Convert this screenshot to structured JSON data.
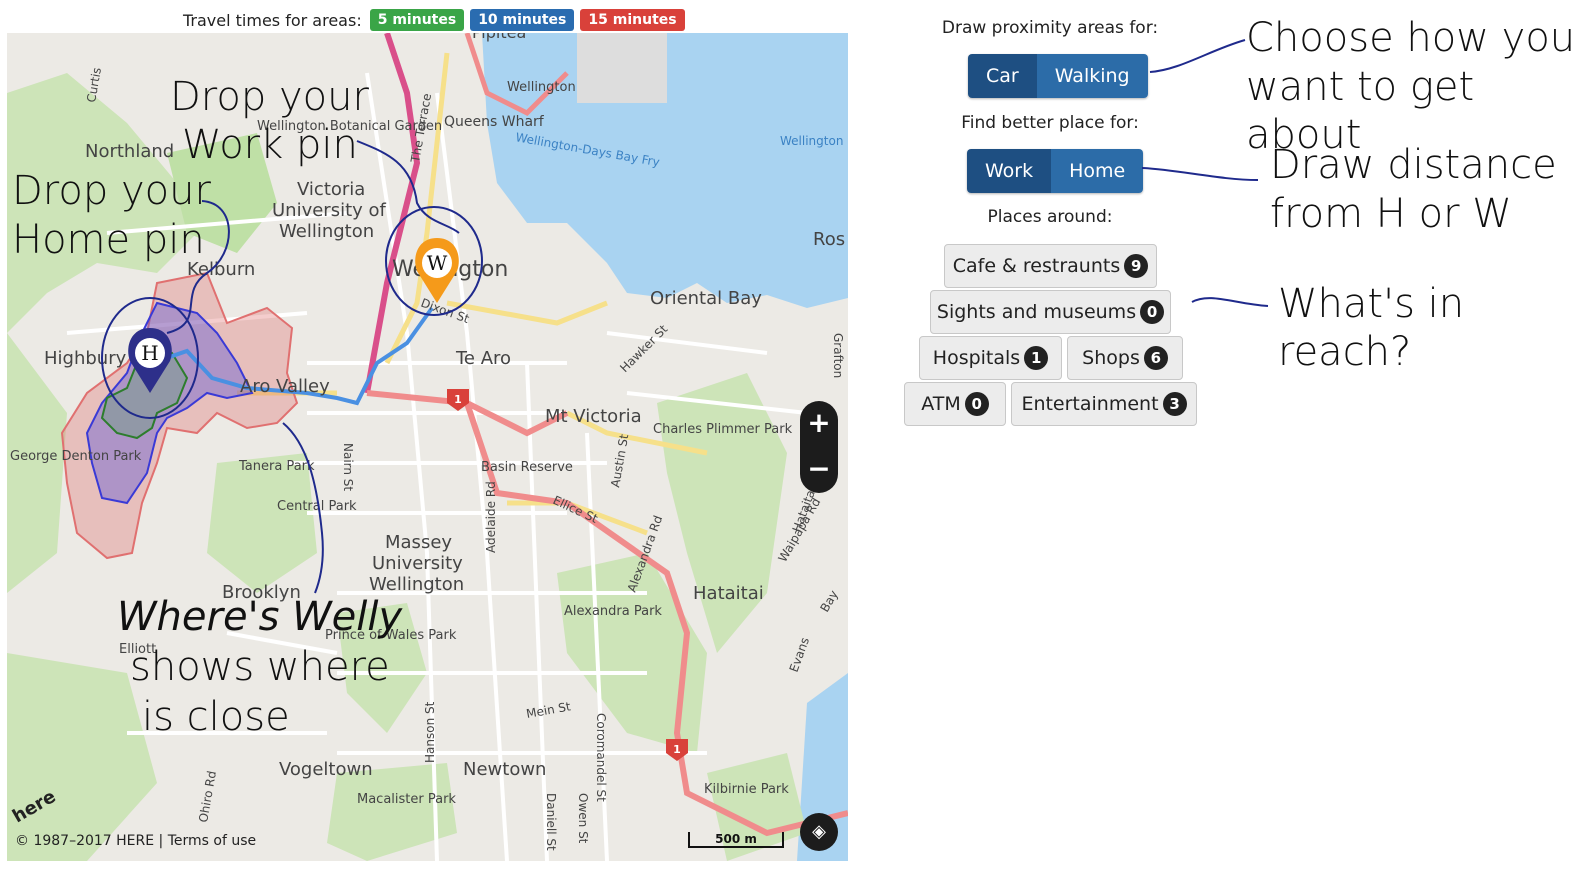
{
  "legend": {
    "label": "Travel times for areas:",
    "badges": [
      {
        "text": "5 minutes",
        "color": "#3aa547"
      },
      {
        "text": "10 minutes",
        "color": "#2a6cb0"
      },
      {
        "text": "15 minutes",
        "color": "#d9413a"
      }
    ]
  },
  "map": {
    "places": {
      "pipitea": "Pipitea",
      "wellington_top": "Wellington",
      "queens_wharf": "Queens Wharf",
      "botanical": "Wellington Botanical Garden",
      "northland": "Northland",
      "victoria_uni_1": "Victoria",
      "victoria_uni_2": "University of",
      "victoria_uni_3": "Wellington",
      "kelburn": "Kelburn",
      "wellington_city": "Wellington",
      "oriental_bay": "Oriental Bay",
      "highbury": "Highbury",
      "aro_valley": "Aro Valley",
      "te_aro": "Te Aro",
      "mt_victoria": "Mt Victoria",
      "charles_plimmer": "Charles Plimmer Park",
      "george_denton": "George Denton Park",
      "tanera": "Tanera Park",
      "central_park": "Central Park",
      "basin_reserve": "Basin Reserve",
      "massey_1": "Massey",
      "massey_2": "University",
      "massey_3": "Wellington",
      "brooklyn": "Brooklyn",
      "hataitai": "Hataitai",
      "alexandra_park": "Alexandra Park",
      "elliott": "Elliott",
      "prince_wales": "Prince of Wales Park",
      "vogeltown": "Vogeltown",
      "newtown": "Newtown",
      "macalister": "Macalister Park",
      "kilbirnie": "Kilbirnie Park",
      "ros": "Ros"
    },
    "streets": {
      "dixon": "Dixon St",
      "ellice": "Ellice St",
      "nairn": "Nairn St",
      "adelaide": "Adelaide Rd",
      "alexandra_rd": "Alexandra Rd",
      "austin": "Austin St",
      "hawker": "Hawker St",
      "mein": "Mein St",
      "hanson": "Hanson St",
      "coromandel": "Coromandel St",
      "daniell": "Daniell St",
      "owen": "Owen St",
      "terrace": "The Terrace",
      "wellington_fry": "Wellington-Days Bay Fry",
      "wellington_right": "Wellington",
      "grafton": "Grafton",
      "hataitai_rd": "Hataitai",
      "waipapa": "Waipapa Rd",
      "evans": "Evans",
      "bay": "Bay",
      "curtis": "Curtis",
      "ohiro": "Ohiro Rd",
      "state_highway": "1"
    },
    "home_pin": "H",
    "work_pin": "W",
    "zoom_in": "+",
    "zoom_out": "−",
    "copyright": "© 1987–2017 HERE | Terms of use",
    "scale": "500 m",
    "logo": "here",
    "overlay_colors": {
      "five": "#3aa547",
      "ten": "#5a55d6",
      "fifteen": "#e07070",
      "route": "#4a90e2"
    }
  },
  "annotations": {
    "work_pin_1": "Drop your",
    "work_pin_2": "Work pin",
    "home_pin_1": "Drop your",
    "home_pin_2": "Home pin",
    "welly_1": "Where's Welly",
    "welly_2": "shows where",
    "welly_3": "is close",
    "choose_1": "Choose how you",
    "choose_2": "want to get about",
    "distance_1": "Draw distance",
    "distance_2": "from H or W",
    "reach": "What's in reach?"
  },
  "panel": {
    "proximity_title": "Draw proximity areas for:",
    "modes": [
      "Car",
      "Walking"
    ],
    "better_title": "Find better place for:",
    "targets": [
      "Work",
      "Home"
    ],
    "places_title": "Places around:",
    "categories": [
      {
        "label": "Cafe & restraunts",
        "count": "9"
      },
      {
        "label": "Sights and museums",
        "count": "0"
      },
      {
        "label": "Hospitals",
        "count": "1"
      },
      {
        "label": "Shops",
        "count": "6"
      },
      {
        "label": "ATM",
        "count": "0"
      },
      {
        "label": "Entertainment",
        "count": "3"
      }
    ],
    "colors": {
      "active": "#1e4f82",
      "inactive": "#2c6ca8"
    }
  }
}
